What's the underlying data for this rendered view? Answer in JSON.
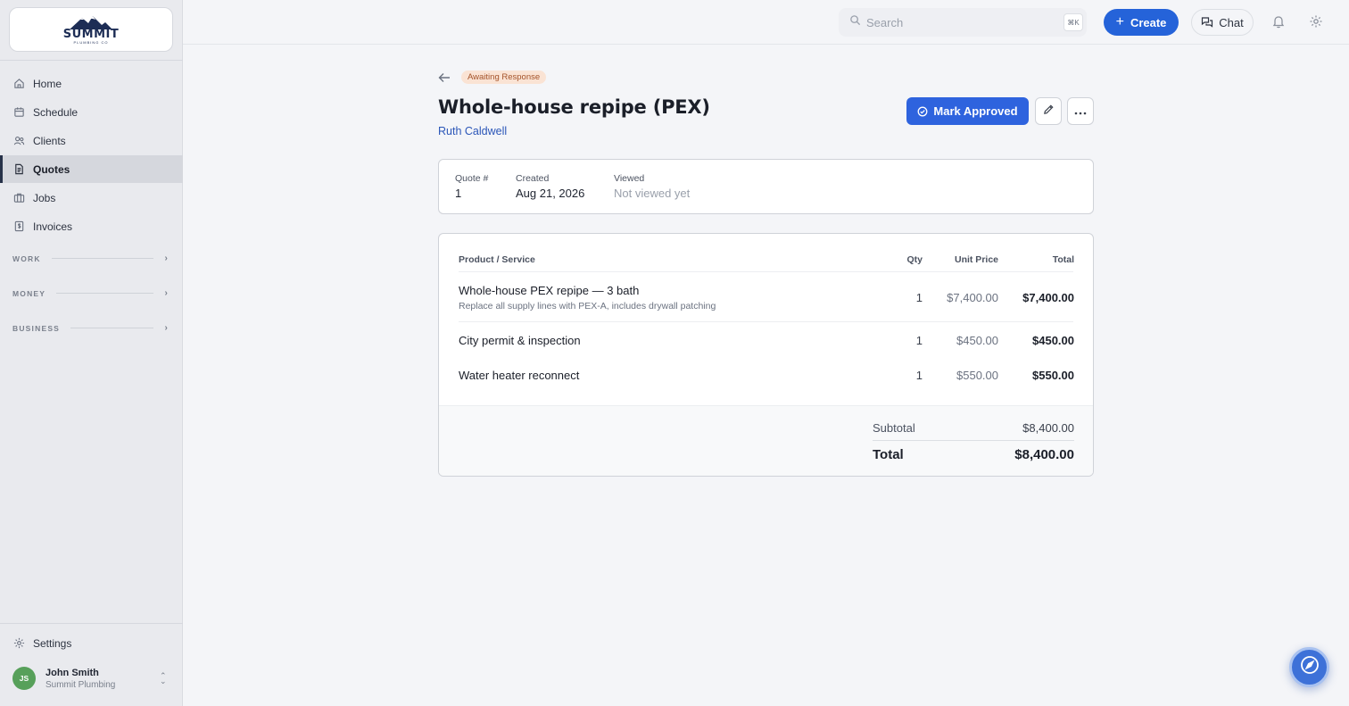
{
  "brand": {
    "name": "SUMMIT",
    "tagline": "PLUMBING CO",
    "color": "#1d2d55"
  },
  "sidebar": {
    "items": [
      {
        "label": "Home",
        "icon": "home-icon"
      },
      {
        "label": "Schedule",
        "icon": "calendar-icon"
      },
      {
        "label": "Clients",
        "icon": "users-icon"
      },
      {
        "label": "Quotes",
        "icon": "document-icon",
        "active": true
      },
      {
        "label": "Jobs",
        "icon": "briefcase-icon"
      },
      {
        "label": "Invoices",
        "icon": "invoice-icon"
      }
    ],
    "sections": [
      "WORK",
      "MONEY",
      "BUSINESS"
    ],
    "settings_label": "Settings",
    "user": {
      "initials": "JS",
      "name": "John Smith",
      "org": "Summit Plumbing"
    }
  },
  "topbar": {
    "search_placeholder": "Search",
    "search_shortcut": "⌘K",
    "create_label": "Create",
    "chat_label": "Chat"
  },
  "quote": {
    "status": "Awaiting Response",
    "title": "Whole-house repipe (PEX)",
    "client": "Ruth Caldwell",
    "approve_label": "Mark Approved",
    "meta": {
      "number_label": "Quote #",
      "number": "1",
      "created_label": "Created",
      "created": "Aug 21, 2026",
      "viewed_label": "Viewed",
      "viewed": "Not viewed yet"
    },
    "table": {
      "headers": {
        "product": "Product / Service",
        "qty": "Qty",
        "unit_price": "Unit Price",
        "total": "Total"
      },
      "rows": [
        {
          "name": "Whole-house PEX repipe — 3 bath",
          "desc": "Replace all supply lines with PEX-A, includes drywall patching",
          "qty": "1",
          "unit_price": "$7,400.00",
          "total": "$7,400.00"
        },
        {
          "name": "City permit & inspection",
          "desc": "",
          "qty": "1",
          "unit_price": "$450.00",
          "total": "$450.00"
        },
        {
          "name": "Water heater reconnect",
          "desc": "",
          "qty": "1",
          "unit_price": "$550.00",
          "total": "$550.00"
        }
      ]
    },
    "subtotal_label": "Subtotal",
    "subtotal": "$8,400.00",
    "total_label": "Total",
    "total": "$8,400.00"
  },
  "colors": {
    "accent": "#2563d9",
    "status_bg": "#fae3d4",
    "status_text": "#a4532a",
    "avatar": "#57a05a"
  }
}
